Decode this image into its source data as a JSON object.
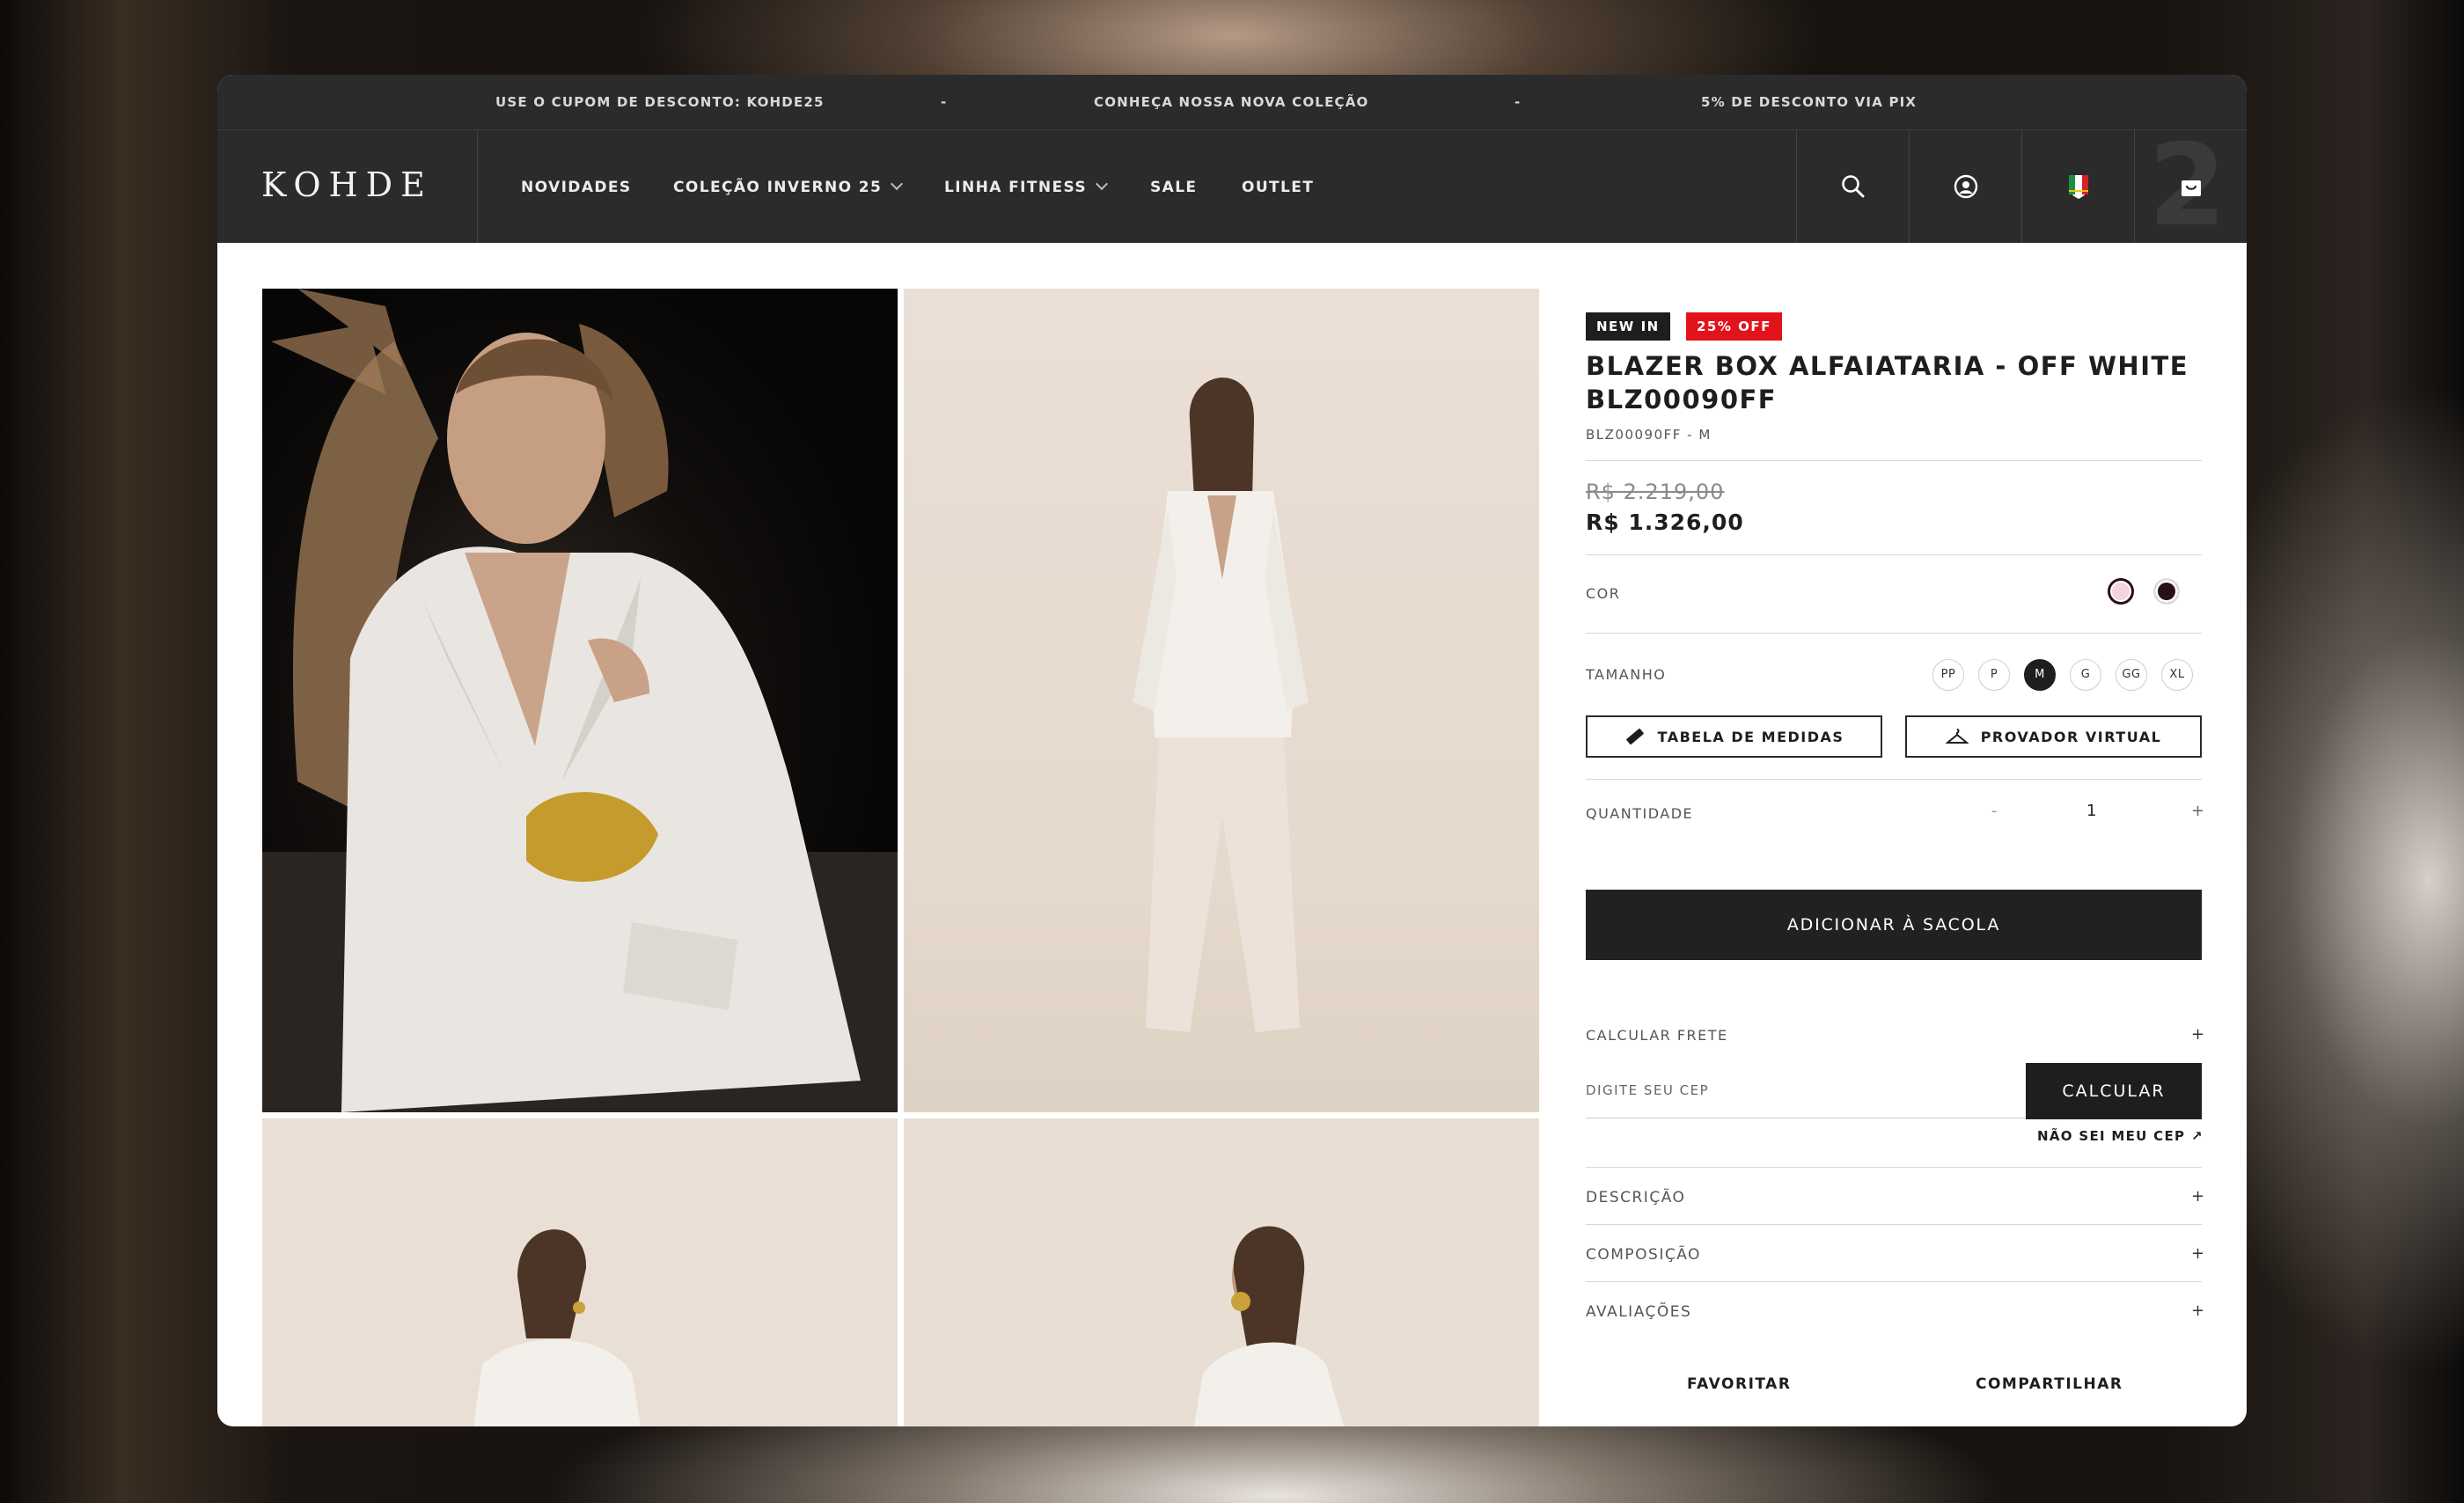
{
  "promo_bar": {
    "messages": [
      "USE O CUPOM DE DESCONTO: KOHDE25",
      "CONHEÇA NOSSA NOVA COLEÇÃO",
      "5% DE DESCONTO VIA PIX"
    ],
    "separator": "-"
  },
  "header": {
    "logo": "KOHDE",
    "nav": [
      "NOVIDADES",
      "COLEÇÃO INVERNO 25",
      "LINHA FITNESS",
      "SALE",
      "OUTLET"
    ],
    "icons": [
      "search-icon",
      "account-icon",
      "flag-icon",
      "bag-icon"
    ],
    "bag_count": "2"
  },
  "product": {
    "badges": [
      "NEW IN",
      "25% OFF"
    ],
    "title": "BLAZER BOX ALFAIATARIA - OFF WHITE BLZ00090FF",
    "sku": "BLZ00090FF - M",
    "price_old": "R$ 2.219,00",
    "price_new": "R$ 1.326,00",
    "color_label": "COR",
    "colors": [
      "#f4d2df",
      "#2a0f15"
    ],
    "size_label": "TAMANHO",
    "sizes": [
      "PP",
      "P",
      "M",
      "G",
      "GG",
      "XL"
    ],
    "selected_size": "M",
    "size_chart_button": "TABELA DE MEDIDAS",
    "virtual_fitting_button": "PROVADOR VIRTUAL",
    "quantity_label": "QUANTIDADE",
    "quantity": "1",
    "quantity_minus": "-",
    "quantity_plus": "+",
    "add_to_bag": "ADICIONAR À SACOLA",
    "shipping_label": "CALCULAR FRETE",
    "cep_placeholder": "DIGITE SEU CEP",
    "calculate_button": "CALCULAR",
    "cep_help": "NÃO SEI MEU CEP",
    "accordions": [
      "DESCRIÇÃO",
      "COMPOSIÇÃO",
      "AVALIAÇÕES"
    ],
    "favorite": "FAVORITAR",
    "share": "COMPARTILHAR"
  },
  "colors": {
    "header_bg": "#2b2b2b",
    "badge_new": "#1e1e1e",
    "badge_sale": "#e3131b",
    "primary_button": "#212121"
  }
}
